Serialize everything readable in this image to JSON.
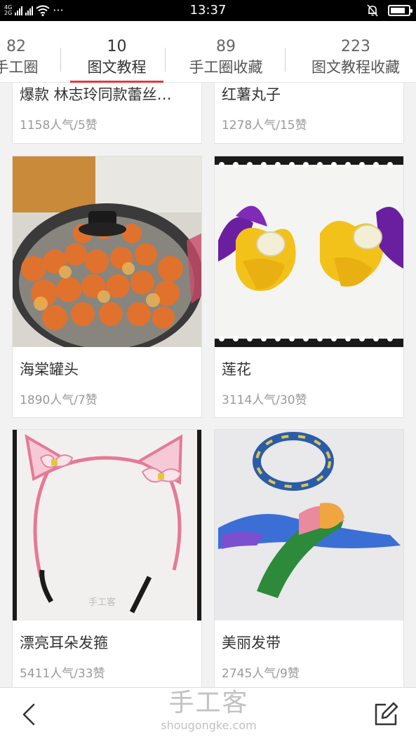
{
  "status_bar": {
    "network_top": "4G",
    "network_bottom": "2G",
    "time": "13:37",
    "more": "···",
    "battery_level": 0.85
  },
  "tabs": [
    {
      "count": "82",
      "label": "手工圈"
    },
    {
      "count": "10",
      "label": "图文教程",
      "active": true
    },
    {
      "count": "89",
      "label": "手工圈收藏"
    },
    {
      "count": "223",
      "label": "图文教程收藏"
    }
  ],
  "cards": [
    {
      "title": "爆款 林志玲同款蕾丝…",
      "stats": "1158人气/5赞"
    },
    {
      "title": "红薯丸子",
      "stats": "1278人气/15赞"
    },
    {
      "title": "海棠罐头",
      "stats": "1890人气/7赞"
    },
    {
      "title": "莲花",
      "stats": "3114人气/30赞"
    },
    {
      "title": "漂亮耳朵发箍",
      "stats": "5411人气/33赞"
    },
    {
      "title": "美丽发带",
      "stats": "2745人气/9赞"
    }
  ],
  "photo_watermark": "手工客",
  "bottom_bar": {
    "watermark_cn": "手工客",
    "watermark_en": "shougongke.com"
  }
}
